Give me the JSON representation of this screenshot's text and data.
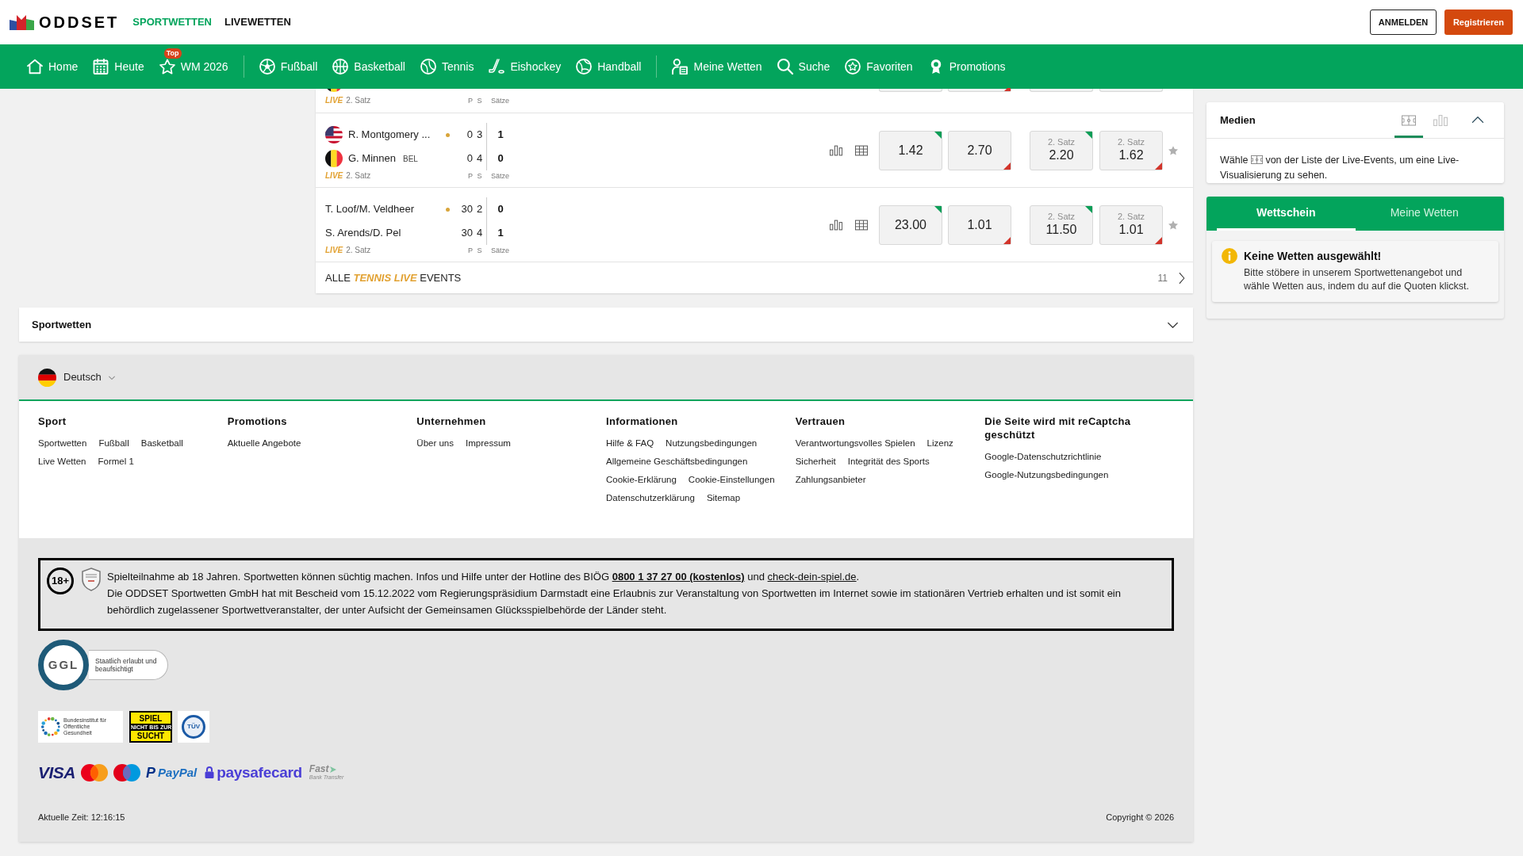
{
  "header": {
    "logo": "ODDSET",
    "tabs": [
      {
        "label": "SPORTWETTEN",
        "selected": true
      },
      {
        "label": "LIVEWETTEN",
        "selected": false
      }
    ],
    "login": "ANMELDEN",
    "register": "Registrieren"
  },
  "nav": {
    "groups": [
      [
        {
          "label": "Home"
        },
        {
          "label": "Heute"
        },
        {
          "label": "WM 2026",
          "badge": "Top"
        }
      ],
      [
        {
          "label": "Fußball"
        },
        {
          "label": "Basketball"
        },
        {
          "label": "Tennis"
        },
        {
          "label": "Eishockey"
        },
        {
          "label": "Handball"
        }
      ],
      [
        {
          "label": "Meine Wetten"
        },
        {
          "label": "Suche"
        },
        {
          "label": "Favoriten"
        },
        {
          "label": "Promotions"
        }
      ]
    ]
  },
  "tennis_live": {
    "rows": [
      {
        "kind": "partial",
        "participants": [
          {
            "kind": "belgium"
          }
        ],
        "status_live": "LIVE",
        "status": "2. Satz",
        "score_labels": [
          "P",
          "S",
          "Sätze"
        ],
        "odds": [
          {
            "rising": true
          },
          {
            "rising": false
          },
          {
            "rising": true
          },
          {
            "rising": true
          }
        ]
      },
      {
        "kind": "full",
        "participants": [
          {
            "kind": "usa",
            "name": "R. Montgomery ...",
            "serving": true,
            "points": "0",
            "games": "3",
            "sets": "1"
          },
          {
            "kind": "belgium",
            "name": "G. Minnen",
            "country": "BEL",
            "serving": false,
            "points": "0",
            "games": "4",
            "sets": "0"
          }
        ],
        "status_live": "LIVE",
        "status": "2. Satz",
        "score_labels": [
          "P",
          "S",
          "Sätze"
        ],
        "odds": [
          {
            "value": "1.42",
            "rising": true
          },
          {
            "value": "2.70",
            "rising": false
          },
          {
            "label": "2. Satz",
            "value": "2.20",
            "rising": true
          },
          {
            "label": "2. Satz",
            "value": "1.62",
            "rising": false
          }
        ],
        "favorite": false
      },
      {
        "kind": "full",
        "participants": [
          {
            "kind": "team",
            "name": "T. Loof/M. Veldheer",
            "serving": true,
            "points": "30",
            "games": "2",
            "sets": "0"
          },
          {
            "kind": "team",
            "name": "S. Arends/D. Pel",
            "serving": false,
            "points": "30",
            "games": "4",
            "sets": "1"
          }
        ],
        "status_live": "LIVE",
        "status": "2. Satz",
        "score_labels": [
          "P",
          "S",
          "Sätze"
        ],
        "odds": [
          {
            "value": "23.00",
            "rising": true
          },
          {
            "value": "1.01",
            "rising": false
          },
          {
            "label": "2. Satz",
            "value": "11.50",
            "rising": true
          },
          {
            "label": "2. Satz",
            "value": "1.01",
            "rising": false
          }
        ],
        "favorite": false
      }
    ],
    "all_link": {
      "prefix": "ALLE",
      "highlight": "TENNIS LIVE",
      "suffix": "EVENTS",
      "count": "11"
    }
  },
  "sports_section": {
    "title": "Sportwetten",
    "expanded": false
  },
  "footer": {
    "language": "Deutsch",
    "columns": [
      {
        "title": "Sport",
        "links": [
          "Sportwetten",
          "Fußball",
          "Basketball",
          "Live Wetten",
          "Formel 1"
        ]
      },
      {
        "title": "Promotions",
        "links": [
          "Aktuelle Angebote"
        ]
      },
      {
        "title": "Unternehmen",
        "links": [
          "Über uns",
          "Impressum"
        ]
      },
      {
        "title": "Informationen",
        "links": [
          "Hilfe & FAQ",
          "Nutzungsbedingungen",
          "Allgemeine Geschäftsbedingungen",
          "Cookie-Erklärung",
          "Cookie-Einstellungen",
          "Datenschutzerklärung",
          "Sitemap"
        ]
      },
      {
        "title": "Vertrauen",
        "links": [
          "Verantwortungsvolles Spielen",
          "Lizenz",
          "Sicherheit",
          "Integrität des Sports",
          "Zahlungsanbieter"
        ]
      },
      {
        "title": "Die Seite wird mit reCaptcha geschützt",
        "links": [
          "Google-Datenschutzrichtlinie",
          "Google-Nutzungsbedingungen"
        ]
      }
    ],
    "legal": {
      "age_badge": "18+",
      "notice": {
        "before": "Spielteilnahme ab 18 Jahren. Sportwetten können süchtig machen. Infos und Hilfe unter der Hotline des BIÖG",
        "hotline": "0800 1 37 27 00 (kostenlos)",
        "between": "und",
        "link": "check-dein-spiel.de",
        "after": "."
      },
      "license": "Die ODDSET Sportwetten GmbH hat mit Bescheid vom 15.12.2022 vom Regierungspräsidium Darmstadt eine Erlaubnis zur Veranstaltung von Sportwetten im Internet sowie im stationären Vertrieb erhalten und ist somit ein behördlich zugelassener Sportwettveranstalter, der unter Aufsicht der Gemeinsamen Glücksspielbehörde der Länder steht."
    },
    "seal": {
      "abbr": "GGL",
      "caption": "Staatlich erlaubt und beaufsichtigt"
    },
    "partners": [
      {
        "kind": "institute",
        "text": "Bundesinstitut für Öffentliche Gesundheit"
      },
      {
        "kind": "addiction",
        "lines": [
          "SPIEL",
          "NICHT BIS ZUR",
          "SUCHT"
        ]
      },
      {
        "kind": "certification",
        "text": "TÜV"
      }
    ],
    "payments": [
      {
        "kind": "visa",
        "text": "VISA"
      },
      {
        "kind": "mastercard"
      },
      {
        "kind": "maestro"
      },
      {
        "kind": "paypal",
        "mark": "P",
        "text": "PayPal"
      },
      {
        "kind": "paysafecard",
        "text": "paysafecard"
      },
      {
        "kind": "fast",
        "text": "Fast",
        "subtext": "Bank Transfer"
      }
    ],
    "time": "Aktuelle Zeit: 12:16:15",
    "copyright": "Copyright © 2026"
  },
  "media": {
    "title": "Medien",
    "tabs": [
      {
        "selected": true
      },
      {
        "selected": false
      }
    ],
    "expanded": true,
    "hint": {
      "before": "Wähle",
      "after": "von der Liste der Live-Events, um eine Live-Visualisierung zu sehen."
    }
  },
  "betslip": {
    "tabs": [
      {
        "label": "Wettschein",
        "selected": true
      },
      {
        "label": "Meine Wetten",
        "selected": false
      }
    ],
    "notice": {
      "title": "Keine Wetten ausgewählt!",
      "text": "Bitte stöbere in unserem Sportwettenangebot und wähle Wetten aus, indem du auf die Quoten klickst."
    }
  }
}
